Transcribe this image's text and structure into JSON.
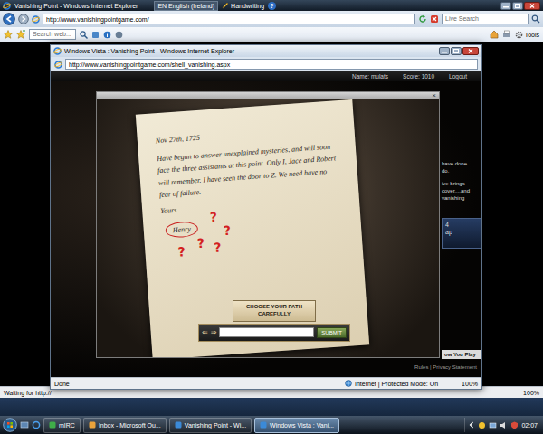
{
  "browser": {
    "title": "Vanishing Point - Windows Internet Explorer",
    "language": "EN English (Ireland)",
    "handwriting": "Handwriting",
    "help": "?",
    "address": "http://www.vanishingpointgame.com/",
    "search": {
      "placeholder": "Live Search"
    },
    "toolbar_search": {
      "placeholder": "Search web..."
    },
    "tools": "Tools",
    "status": "Waiting for http://",
    "zoom": "100%"
  },
  "popup": {
    "title": "Windows Vista : Vanishing Point - Windows Internet Explorer",
    "address": "http://www.vanishingpointgame.com/shell_vanishing.aspx",
    "status": "Done",
    "zone": "Internet | Protected Mode: On",
    "zoom": "100%"
  },
  "header": {
    "name": "Name: mulats",
    "score": "Score: 1010",
    "logout": "Logout"
  },
  "modal": {
    "close": "×"
  },
  "note": {
    "date": "Nov 27th, 1725",
    "body": "Have begun to answer unexplained mysteries, and will soon face the three assistants at this point. Only I, Jace and Robert will remember. I have seen the door to Z. We need have no fear of failure.",
    "closing": "Yours",
    "signature": "Henry",
    "marks": [
      "?",
      "?",
      "?",
      "?",
      "?"
    ]
  },
  "answer": {
    "prompt": "CHOOSE YOUR PATH CAREFULLY",
    "back": "⇐",
    "forward": "⇒",
    "value": "",
    "submit": "SUBMIT"
  },
  "sidebar": {
    "lines": [
      "have done",
      "do.",
      "ive brings",
      "cover....and",
      "vanishing"
    ],
    "card": [
      "4",
      "ap"
    ],
    "how": "ow You Play",
    "footer": "Rules | Privacy Statement"
  },
  "taskbar": {
    "items": [
      {
        "label": "mIRC",
        "selected": false
      },
      {
        "label": "Inbox - Microsoft Ou...",
        "selected": false
      },
      {
        "label": "Vanishing Point - Wi...",
        "selected": false
      },
      {
        "label": "Windows Vista : Vani...",
        "selected": true
      }
    ],
    "clock": "02:07"
  }
}
